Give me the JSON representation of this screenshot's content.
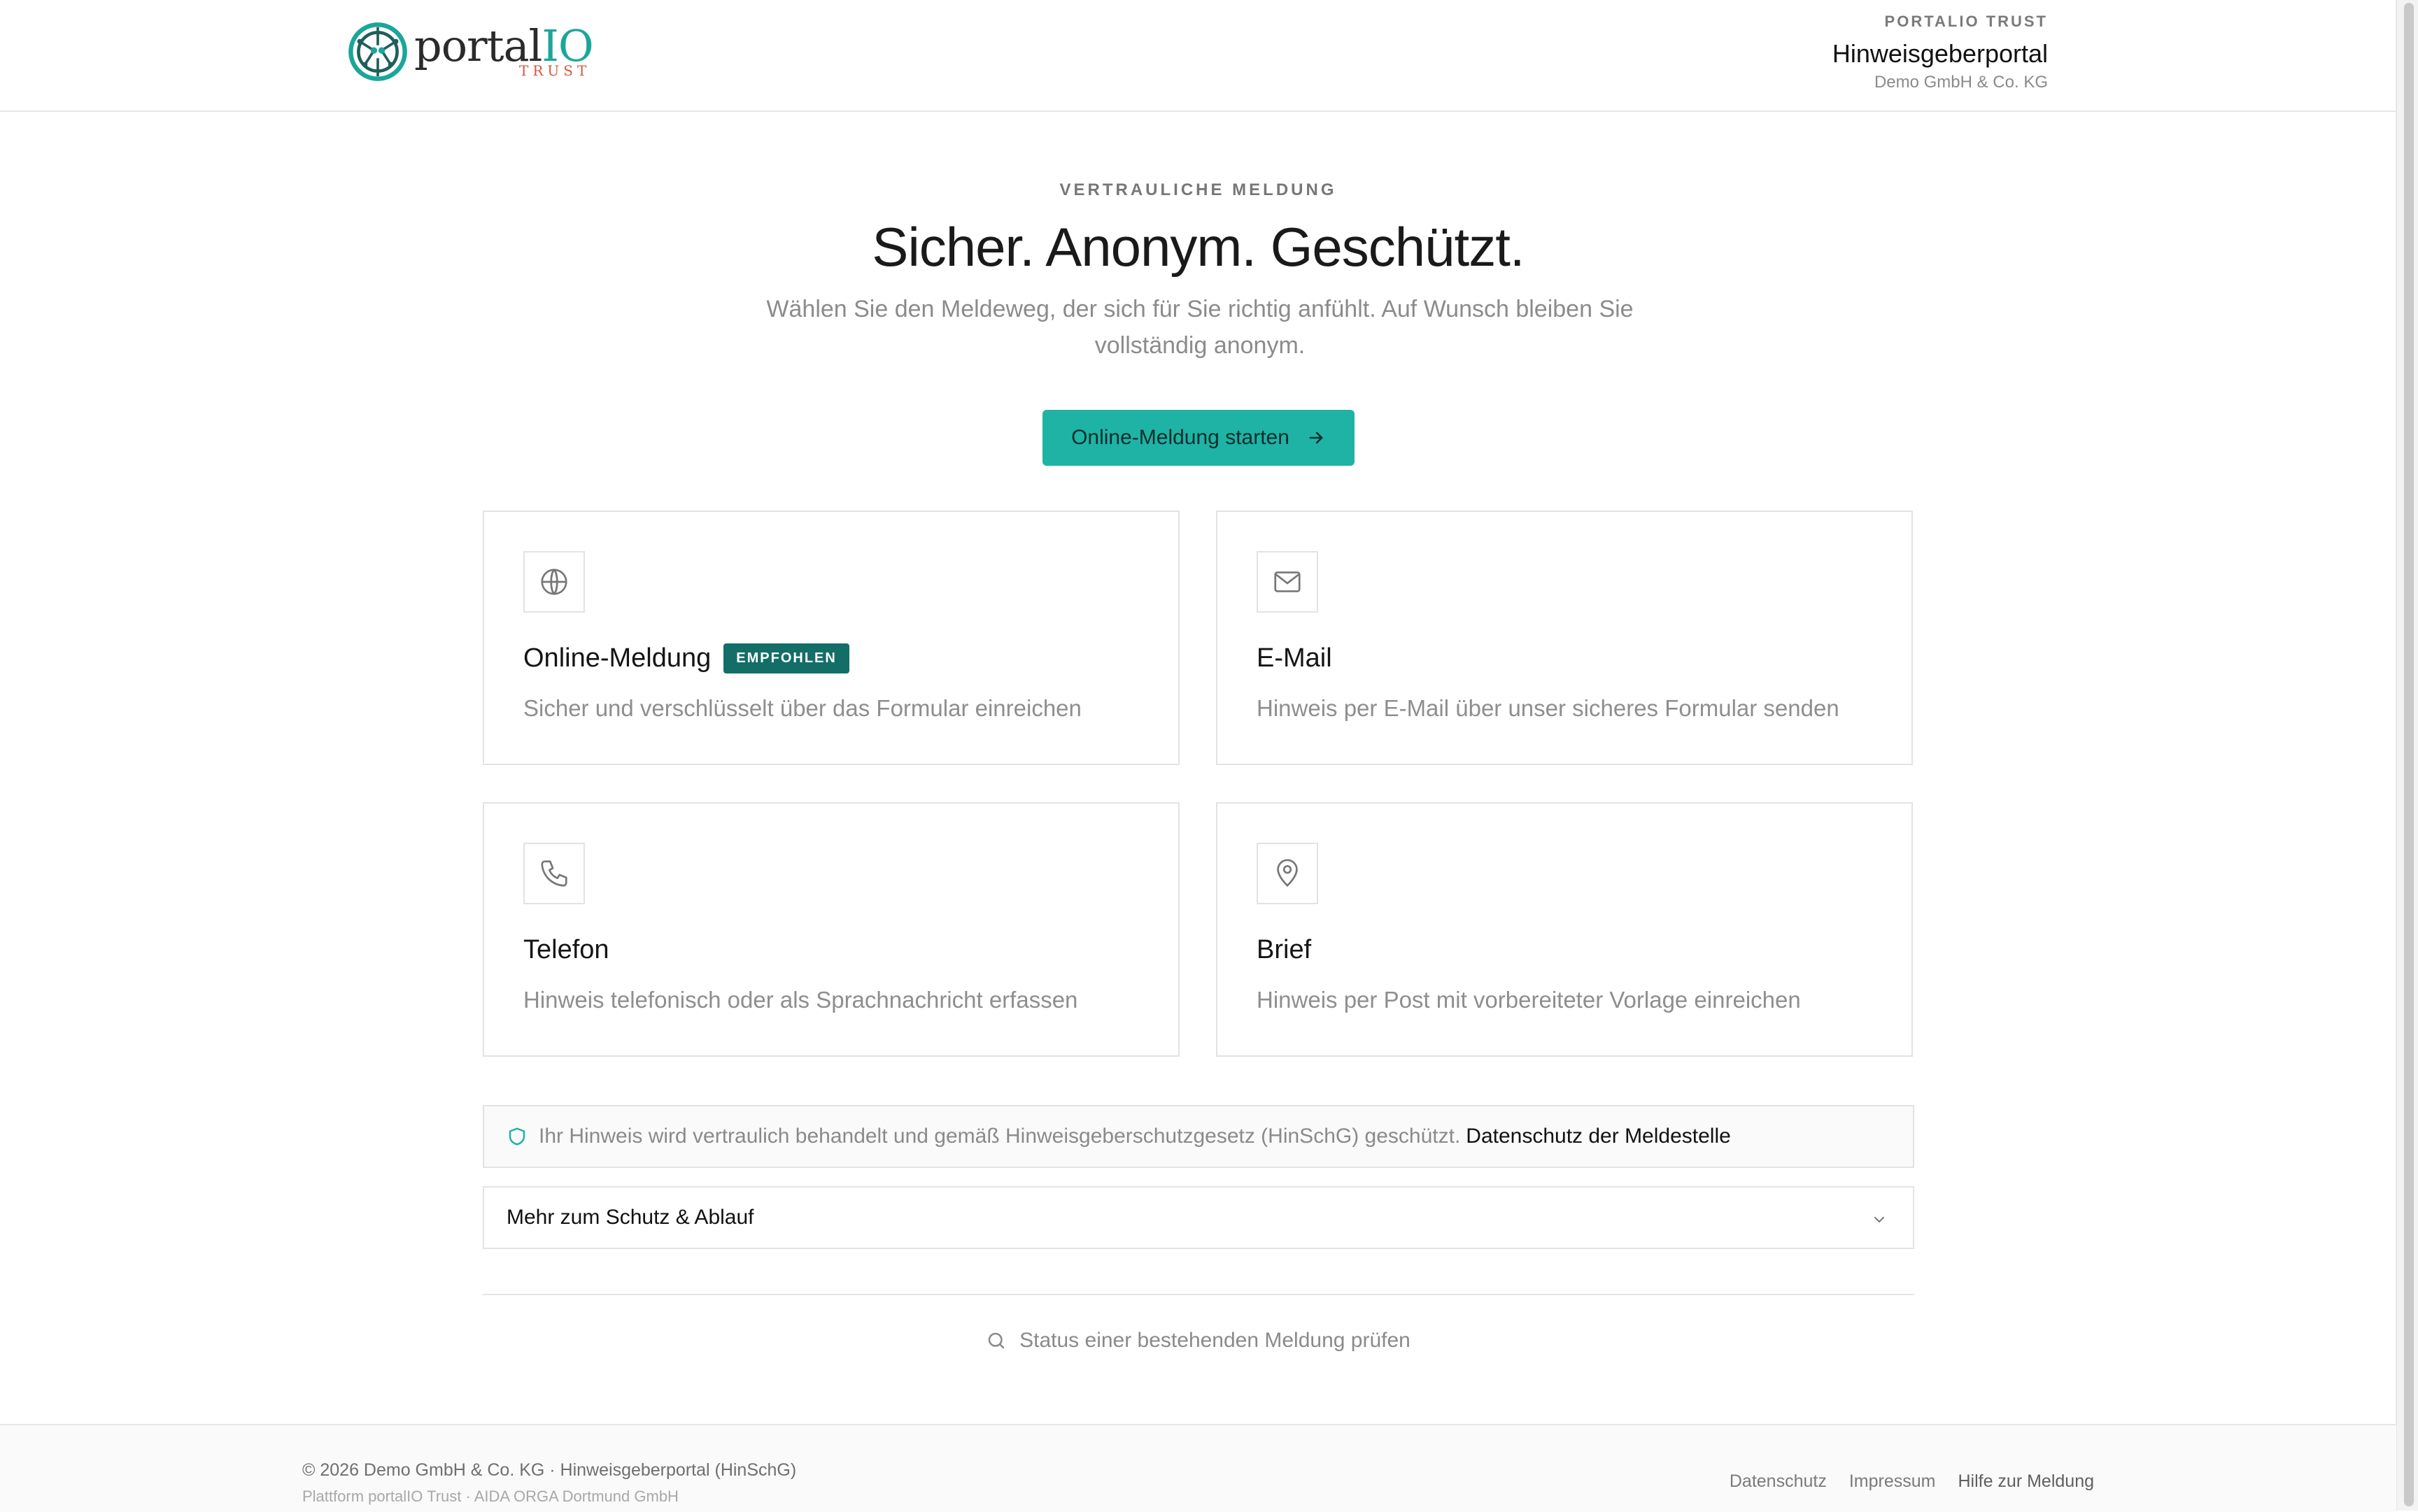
{
  "brand": {
    "logo_word_main": "portal",
    "logo_word_accent": "IO",
    "logo_sub": "TRUST",
    "accent": "#1fb3a6",
    "accent_dark": "#136e67",
    "logo_sub_color": "#d8563c"
  },
  "header": {
    "eyebrow": "PORTALIO TRUST",
    "title": "Hinweisgeberportal",
    "subtitle": "Demo GmbH & Co. KG"
  },
  "hero": {
    "eyebrow": "VERTRAULICHE MELDUNG",
    "title": "Sicher. Anonym. Geschützt.",
    "lead": "Wählen Sie den Meldeweg, der sich für Sie richtig anfühlt. Auf Wunsch bleiben Sie vollständig anonym.",
    "cta_label": "Online-Meldung starten"
  },
  "cards": [
    {
      "icon": "globe-icon",
      "title": "Online-Meldung",
      "badge": "EMPFOHLEN",
      "desc": "Sicher und verschlüsselt über das Formular einreichen"
    },
    {
      "icon": "mail-icon",
      "title": "E-Mail",
      "desc": "Hinweis per E-Mail über unser sicheres Formular senden"
    },
    {
      "icon": "phone-icon",
      "title": "Telefon",
      "desc": "Hinweis telefonisch oder als Sprachnachricht erfassen"
    },
    {
      "icon": "map-pin-icon",
      "title": "Brief",
      "desc": "Hinweis per Post mit vorbereiteter Vorlage einreichen"
    }
  ],
  "notice": {
    "text": "Ihr Hinweis wird vertraulich behandelt und gemäß Hinweisgeberschutzgesetz (HinSchG) geschützt.",
    "link": "Datenschutz der Meldestelle"
  },
  "accordion": {
    "label": "Mehr zum Schutz & Ablauf"
  },
  "status": {
    "label": "Status einer bestehenden Meldung prüfen"
  },
  "footer": {
    "copyright": "© 2026 Demo GmbH & Co. KG · Hinweisgeberportal (HinSchG)",
    "platform": "Plattform portalIO Trust · AIDA ORGA Dortmund GmbH",
    "links": [
      "Datenschutz",
      "Impressum",
      "Hilfe zur Meldung"
    ]
  }
}
